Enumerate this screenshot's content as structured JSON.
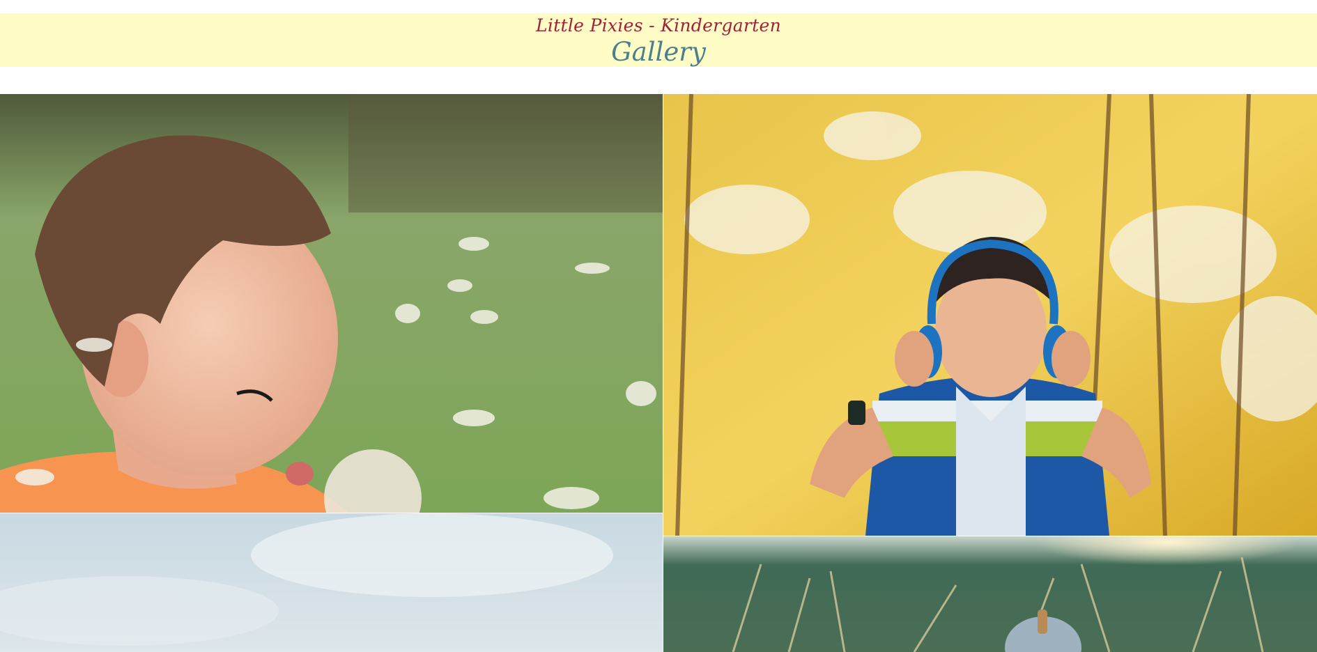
{
  "header": {
    "site_title": "Little Pixies - Kindergarten",
    "page_title": "Gallery"
  },
  "gallery": {
    "photos": [
      {
        "subject": "boy blowing dandelion"
      },
      {
        "subject": "boy with headphones in autumn trees"
      },
      {
        "subject": "sky"
      },
      {
        "subject": "child in tall grass at sunset"
      }
    ]
  },
  "colors": {
    "header_bg": "#fffcc5",
    "site_title": "#a0223a",
    "page_title": "#4a7f8e"
  }
}
